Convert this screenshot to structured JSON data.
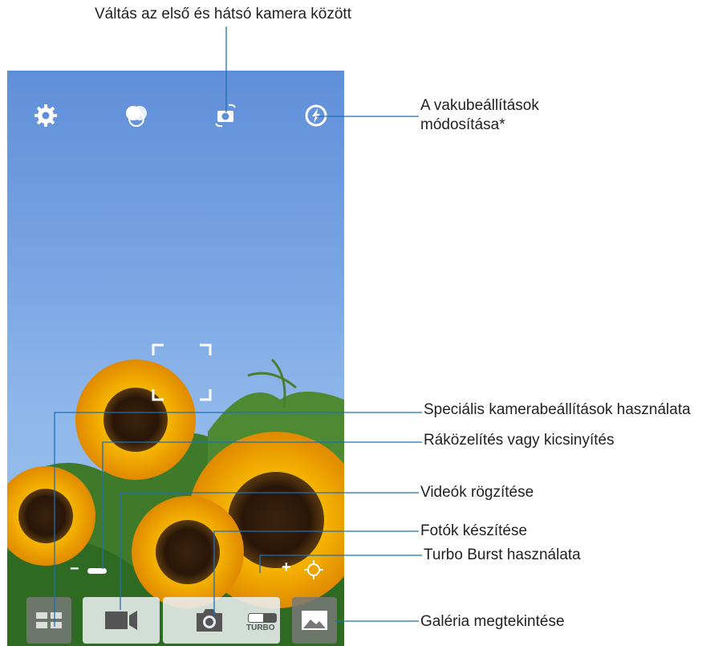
{
  "callouts": {
    "camera_switch": "Váltás az első és hátsó kamera között",
    "flash_line1": "A vakubeállítások",
    "flash_line2": "módosítása*",
    "special_settings": "Speciális kamerabeállítások használata",
    "zoom": "Ráközelítés vagy kicsinyítés",
    "video": "Videók rögzítése",
    "photo": "Fotók készítése",
    "turbo_burst": "Turbo Burst használata",
    "gallery": "Galéria megtekintése"
  },
  "camera_ui": {
    "top_icons": [
      "gear-icon",
      "color-effects-icon",
      "camera-switch-icon",
      "flash-auto-icon"
    ],
    "zoom_minus": "−",
    "zoom_plus": "+",
    "turbo_label": "TURBO"
  },
  "colors": {
    "line": "#1f6fb5",
    "sky_top": "#5f8fd9",
    "sky_bottom": "#9cc2ee"
  }
}
